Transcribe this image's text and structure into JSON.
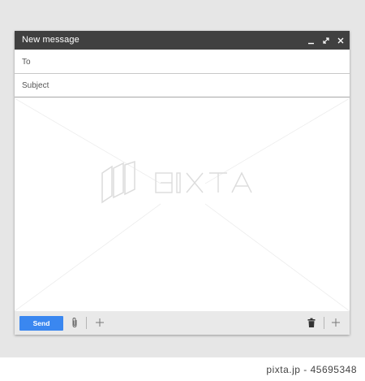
{
  "window": {
    "title": "New message",
    "controls": {
      "minimize_icon": "minimize-icon",
      "expand_icon": "expand-icon",
      "close_icon": "close-icon"
    }
  },
  "compose": {
    "to_label": "To",
    "subject_label": "Subject",
    "body_text": ""
  },
  "footer": {
    "send_label": "Send",
    "attach_icon": "paperclip-icon",
    "add_icon": "plus-icon",
    "delete_icon": "trash-icon",
    "more_icon": "plus-icon"
  },
  "watermark": {
    "brand": "PIXTA"
  },
  "caption": {
    "text": "pixta.jp - 45695348"
  },
  "colors": {
    "titlebar": "#404040",
    "send_button": "#3a87f0",
    "footer_background": "#e9e9e9",
    "page_background": "#e6e6e6"
  }
}
